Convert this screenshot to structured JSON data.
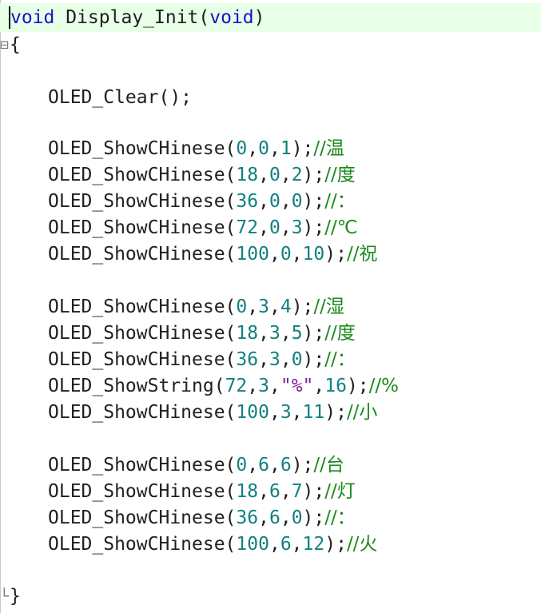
{
  "editor": {
    "signature": {
      "keyword": "void",
      "name": " Display_Init(",
      "param": "void",
      "close": ")"
    },
    "open_brace": "{",
    "close_brace": "}",
    "clear_call": "OLED_Clear();",
    "calls": [
      {
        "fn": "OLED_ShowCHinese(",
        "args": "0,0,1",
        "tail": ");",
        "comment": "//温"
      },
      {
        "fn": "OLED_ShowCHinese(",
        "args": "18,0,2",
        "tail": ");",
        "comment": "//度"
      },
      {
        "fn": "OLED_ShowCHinese(",
        "args": "36,0,0",
        "tail": ");",
        "comment": "//："
      },
      {
        "fn": "OLED_ShowCHinese(",
        "args": "72,0,3",
        "tail": ");",
        "comment": "//℃"
      },
      {
        "fn": "OLED_ShowCHinese(",
        "args": "100,0,10",
        "tail": ");",
        "comment": "//祝"
      },
      {
        "fn": "OLED_ShowCHinese(",
        "args": "0,3,4",
        "tail": ");",
        "comment": "//湿"
      },
      {
        "fn": "OLED_ShowCHinese(",
        "args": "18,3,5",
        "tail": ");",
        "comment": "//度"
      },
      {
        "fn": "OLED_ShowCHinese(",
        "args": "36,3,0",
        "tail": ");",
        "comment": "//："
      },
      {
        "fn": "OLED_ShowString(",
        "args": "72,3,",
        "str": "\"%\"",
        "args2": ",16",
        "tail": ");",
        "comment": "//%"
      },
      {
        "fn": "OLED_ShowCHinese(",
        "args": "100,3,11",
        "tail": ");",
        "comment": "//小"
      },
      {
        "fn": "OLED_ShowCHinese(",
        "args": "0,6,6",
        "tail": ");",
        "comment": "//台"
      },
      {
        "fn": "OLED_ShowCHinese(",
        "args": "18,6,7",
        "tail": ");",
        "comment": "//灯"
      },
      {
        "fn": "OLED_ShowCHinese(",
        "args": "36,6,0",
        "tail": ");",
        "comment": "//："
      },
      {
        "fn": "OLED_ShowCHinese(",
        "args": "100,6,12",
        "tail": ");",
        "comment": "//火"
      }
    ]
  }
}
